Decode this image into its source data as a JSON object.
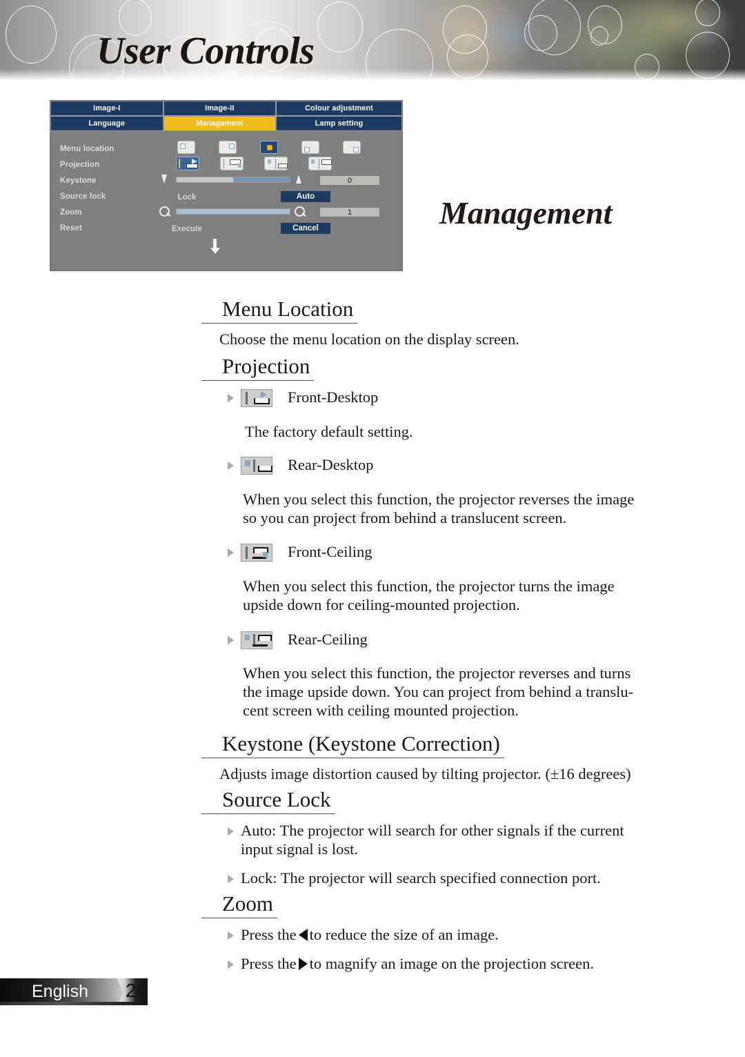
{
  "banner": {
    "title": "User Controls"
  },
  "section_title": "Management",
  "osd": {
    "tabs_row1": [
      "Image-I",
      "Image-II",
      "Colour adjustment"
    ],
    "tabs_row2": [
      "Language",
      "Management",
      "Lamp setting"
    ],
    "active_tab": "Management",
    "accent_active": "#f0bc1e",
    "accent_tab": "#1e3a61",
    "rows": [
      {
        "label": "Menu location"
      },
      {
        "label": "Projection"
      },
      {
        "label": "Keystone",
        "value": "0"
      },
      {
        "label": "Source lock"
      },
      {
        "label": "Zoom",
        "value": "1"
      },
      {
        "label": "Reset"
      }
    ],
    "source_lock": {
      "option_left": "Lock",
      "option_right": "Auto",
      "selected": "Auto"
    },
    "reset": {
      "option_left": "Execute",
      "option_right": "Cancel",
      "selected": "Cancel"
    },
    "keystone_value": "0",
    "zoom_value": "1",
    "menu_location_selected_index": 2,
    "projection_selected_index": 0
  },
  "sections": {
    "menu_location": {
      "heading": "Menu Location",
      "body": "Choose the menu location on the display screen."
    },
    "projection": {
      "heading": "Projection",
      "items": [
        {
          "label": "Front-Desktop",
          "body": "The factory default setting."
        },
        {
          "label": "Rear-Desktop",
          "body": "When you select this function, the projector reverses the image\nso you can project from behind a translucent screen."
        },
        {
          "label": "Front-Ceiling",
          "body": "When you select this function, the projector turns the image\nupside down for ceiling-mounted projection."
        },
        {
          "label": "Rear-Ceiling",
          "body": "When you select this function, the projector reverses and turns\nthe image upside down. You can project from behind a translu-\ncent screen with ceiling mounted projection."
        }
      ]
    },
    "keystone": {
      "heading": "Keystone (Keystone Correction)",
      "body": "Adjusts image distortion caused by tilting projector. (±16 degrees)"
    },
    "source_lock": {
      "heading": "Source Lock",
      "bullets": [
        "Auto: The projector will search for other signals if the current\ninput signal is lost.",
        "Lock: The projector will search specified connection port."
      ]
    },
    "zoom": {
      "heading": "Zoom",
      "bullets": [
        {
          "pre": "Press the",
          "arrow": "arrow-left",
          "post": "to reduce the size of an image."
        },
        {
          "pre": "Press the",
          "arrow": "arrow-right",
          "post": "to magnify an image on the projection screen."
        }
      ]
    }
  },
  "footer": {
    "language": "English",
    "page": "26"
  }
}
